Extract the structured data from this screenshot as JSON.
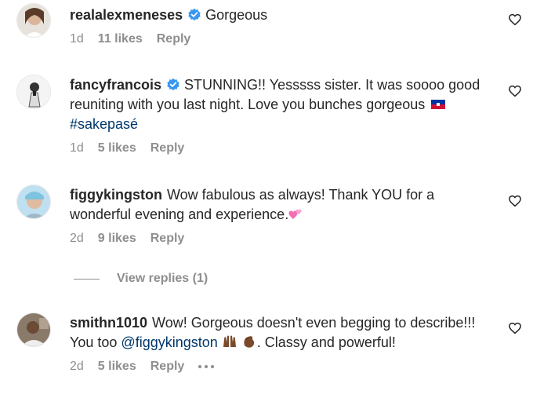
{
  "comments": [
    {
      "username": "realalexmeneses",
      "verified": true,
      "text": "Gorgeous",
      "age": "1d",
      "likes": "11 likes",
      "reply": "Reply"
    },
    {
      "username": "fancyfrancois",
      "verified": true,
      "text_before": "STUNNING!! Yesssss sister. It was soooo good reuniting with you last night. Love you bunches gorgeous",
      "hashtag": "#sakepasé",
      "age": "1d",
      "likes": "5 likes",
      "reply": "Reply"
    },
    {
      "username": "figgykingston",
      "verified": false,
      "text": "Wow fabulous as always! Thank YOU for a wonderful evening and experience.",
      "age": "2d",
      "likes": "9 likes",
      "reply": "Reply",
      "view_replies": "View replies (1)"
    },
    {
      "username": "smithn1010",
      "verified": false,
      "text_before": "Wow! Gorgeous doesn't even begging to describe!!! You too",
      "mention": "@figgykingston",
      "text_after": ". Classy and powerful!",
      "age": "2d",
      "likes": "5 likes",
      "reply": "Reply"
    }
  ],
  "icons": {
    "verified": "verified-badge-icon",
    "heart": "heart-outline-icon",
    "more": "more-options-icon",
    "flag": "haiti-flag-emoji",
    "hearts_emoji": "two-hearts-emoji",
    "raised_hands": "raised-hands-emoji",
    "clapping": "clapping-hands-emoji"
  },
  "colors": {
    "verified": "#3897f0",
    "link": "#00376b",
    "meta": "#8e8e8e",
    "text": "#262626"
  }
}
